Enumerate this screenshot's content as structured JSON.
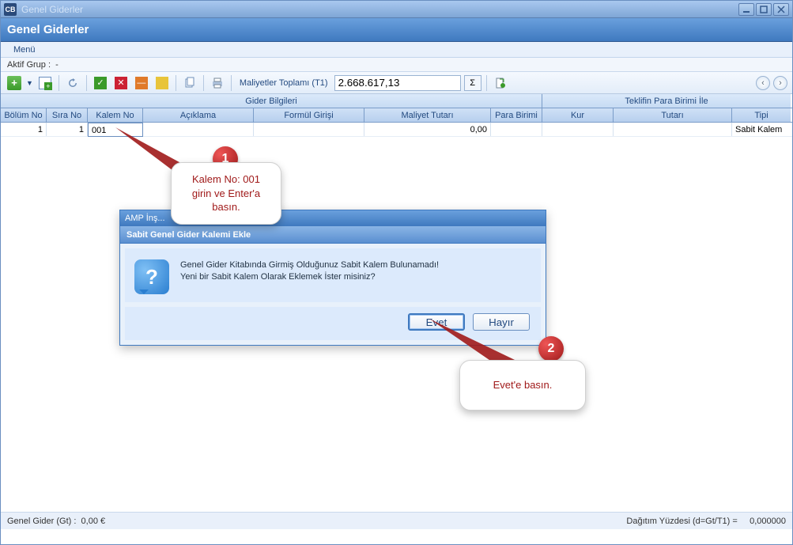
{
  "window": {
    "icon_text": "CB",
    "title": "Genel Giderler"
  },
  "header": {
    "title": "Genel Giderler"
  },
  "menubar": {
    "menu_label": "Menü"
  },
  "groupbar": {
    "label": "Aktif Grup :",
    "value": "-"
  },
  "toolbar": {
    "total_label": "Maliyetler Toplamı (T1)",
    "total_value": "2.668.617,13",
    "sigma": "Σ"
  },
  "grid": {
    "group_gider": "Gider Bilgileri",
    "group_teklif": "Teklifin Para Birimi İle",
    "cols": {
      "bolum": "Bölüm No",
      "sira": "Sıra No",
      "kalem": "Kalem No",
      "aciklama": "Açıklama",
      "formul": "Formül Girişi",
      "maliyet": "Maliyet Tutarı",
      "para": "Para Birimi",
      "kur": "Kur",
      "tutar": "Tutarı",
      "tipi": "Tipi"
    },
    "rows": [
      {
        "bolum": "1",
        "sira": "1",
        "kalem": "001",
        "aciklama": "",
        "formul": "",
        "maliyet": "0,00",
        "para": "",
        "kur": "",
        "tutar": "",
        "tipi": "Sabit Kalem"
      }
    ]
  },
  "dialog": {
    "titlebar": "AMP İnş...",
    "subtitle": "Sabit Genel Gider Kalemi Ekle",
    "line1": "Genel Gider Kitabında Girmiş Olduğunuz Sabit Kalem Bulunamadı!",
    "line2": "Yeni bir Sabit Kalem Olarak Eklemek İster misiniz?",
    "icon_glyph": "?",
    "yes": "Evet",
    "no": "Hayır"
  },
  "callouts": {
    "c1_num": "1",
    "c1_text_l1": "Kalem No: 001",
    "c1_text_l2": "girin ve Enter'a",
    "c1_text_l3": "basın.",
    "c2_num": "2",
    "c2_text": "Evet'e basın."
  },
  "statusbar": {
    "left_label": "Genel Gider (Gt) :",
    "left_value": "0,00 €",
    "right_label": "Dağıtım Yüzdesi (d=Gt/T1) =",
    "right_value": "0,000000"
  }
}
